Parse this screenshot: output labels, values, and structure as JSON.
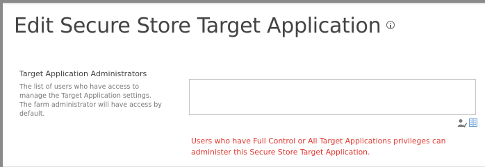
{
  "page": {
    "title": "Edit Secure Store Target Application"
  },
  "icons": {
    "title_info": "info-icon",
    "check_names": "check-names-icon",
    "browse": "address-book-icon"
  },
  "section": {
    "heading": "Target Application Administrators",
    "description": "The list of users who have access to manage the Target Application settings. The farm administrator will have access by default."
  },
  "people_picker": {
    "value": ""
  },
  "warning": {
    "text": "Users who have Full Control or All Target Applications privileges can administer this Secure Store Target Application."
  },
  "colors": {
    "title": "#444444",
    "description": "#777777",
    "warning": "#e0352c",
    "input_border": "#c6c6c6"
  }
}
